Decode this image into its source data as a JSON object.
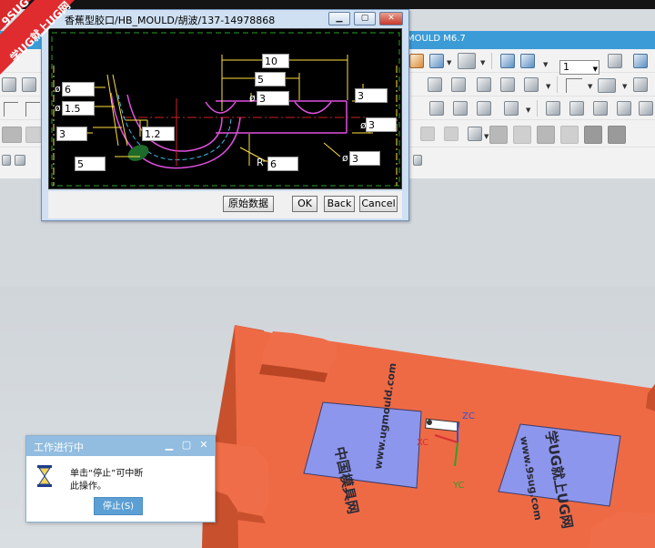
{
  "watermark": {
    "line1": "9SUG",
    "line2": "学UG就上UG网"
  },
  "nx_window": {
    "title": "MOULD M6.7",
    "combo_value": "1"
  },
  "dialog": {
    "title": "香蕉型胶口/HB_MOULD/胡波/137-14978868",
    "buttons": {
      "original": "原始数据",
      "ok": "OK",
      "back": "Back",
      "cancel": "Cancel"
    },
    "labels": {
      "phi": "ø",
      "radius": "R"
    },
    "fields": {
      "top_10": "10",
      "top_5": "5",
      "dia_3_top": "3",
      "right_3": "3",
      "right_dia_3": "3",
      "left_dia_6": "6",
      "left_dia_1_5": "1.5",
      "left_3": "3",
      "mid_1_2": "1.2",
      "bottom_5": "5",
      "radius_6": "6",
      "bottom_dia_3": "3"
    }
  },
  "viewport": {
    "engraving_left_line1": "中国模具网",
    "engraving_left_line2": "www.ugmould.com",
    "engraving_right_line1": "学UG就上UG网",
    "engraving_right_line2": "www.9sug.com",
    "axis_zc": "ZC",
    "axis_xc": "XC",
    "axis_yc": "YC",
    "plate_color": "#ee6a45",
    "panel_color": "#8c96ec"
  },
  "work_dialog": {
    "title": "工作进行中",
    "message_line1": "单击“停止”可中断",
    "message_line2": "此操作。",
    "stop_button": "停止(S)"
  }
}
